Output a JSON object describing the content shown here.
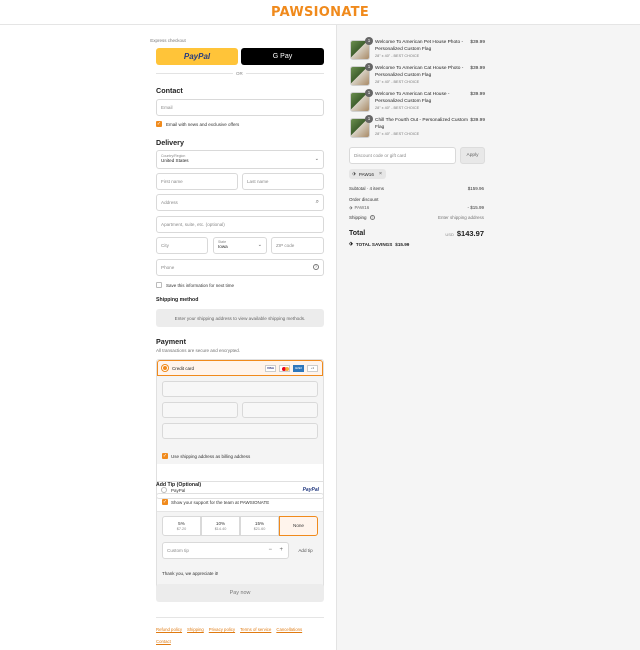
{
  "brand": "PAWSIONATE",
  "express": {
    "title": "Express checkout",
    "paypal": "PayPal",
    "gpay": "G Pay",
    "or": "OR"
  },
  "contact": {
    "title": "Contact",
    "email_placeholder": "Email",
    "news_label": "Email with news and exclusive offers"
  },
  "delivery": {
    "title": "Delivery",
    "country_label": "Country/Region",
    "country_value": "United States",
    "first_name": "First name",
    "last_name": "Last name",
    "address": "Address",
    "apartment": "Apartment, suite, etc. (optional)",
    "city": "City",
    "state_label": "State",
    "state_value": "Iowa",
    "zip": "ZIP code",
    "phone": "Phone",
    "save_label": "Save this information for next time"
  },
  "shipping": {
    "title": "Shipping method",
    "message": "Enter your shipping address to view available shipping methods."
  },
  "payment": {
    "title": "Payment",
    "subtitle": "All transactions are secure and encrypted.",
    "credit_card": "Credit card",
    "cards": [
      "VISA",
      "MC",
      "AMEX",
      "+3"
    ],
    "billing_label": "Use shipping address as billing address",
    "paypal": "PayPal",
    "paypal_logo": "PayPal"
  },
  "tip": {
    "title": "Add Tip (Optional)",
    "support_label": "Show your support for the team at PAWSIONATE",
    "options": [
      {
        "pct": "5%",
        "amt": "$7.20"
      },
      {
        "pct": "10%",
        "amt": "$14.40"
      },
      {
        "pct": "15%",
        "amt": "$21.60"
      },
      {
        "pct": "None",
        "amt": ""
      }
    ],
    "custom_placeholder": "Custom tip",
    "minus": "−",
    "plus": "+",
    "add_label": "Add tip",
    "thanks": "Thank you, we appreciate it!"
  },
  "pay_button": "Pay now",
  "footer_links": [
    "Refund policy",
    "Shipping",
    "Privacy policy",
    "Terms of service",
    "Cancellations",
    "Contact"
  ],
  "cart": {
    "items": [
      {
        "qty": "1",
        "name": "Welcome To American Pet House Photo - Personalized Custom Flag",
        "variant": "28\" x 40\" - BEST CHOICE",
        "price": "$39.99"
      },
      {
        "qty": "1",
        "name": "Welcome To American Cat House Photo - Personalized Custom Flag",
        "variant": "28\" x 40\" - BEST CHOICE",
        "price": "$39.99"
      },
      {
        "qty": "1",
        "name": "Welcome To American Cat House - Personalized Custom Flag",
        "variant": "28\" x 40\" - BEST CHOICE",
        "price": "$39.99"
      },
      {
        "qty": "1",
        "name": "Chill The Fourth Out - Personalized Custom Flag",
        "variant": "28\" x 40\" - BEST CHOICE",
        "price": "$39.99"
      }
    ],
    "discount_placeholder": "Discount code or gift card",
    "apply": "Apply",
    "code_tag": "PAW16",
    "subtotal_label": "Subtotal · 4 items",
    "subtotal_value": "$159.96",
    "order_discount_label": "Order discount",
    "code_line": "PAW16",
    "discount_value": "- $15.99",
    "shipping_label": "Shipping",
    "shipping_value": "Enter shipping address",
    "total_label": "Total",
    "currency": "USD",
    "total_value": "$143.97",
    "savings_label": "TOTAL SAVINGS",
    "savings_value": "$15.99"
  },
  "colors": {
    "accent": "#f08a1c",
    "paypal_yellow": "#ffc439",
    "link": "#e07a10"
  }
}
